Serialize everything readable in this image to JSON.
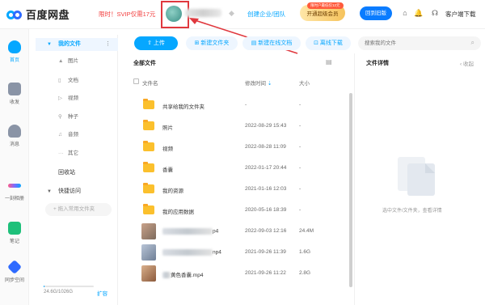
{
  "header": {
    "logo_text": "百度网盘",
    "promo_text": "限时！SVIP仅需17元",
    "team_link": "创建企业/团队",
    "vip_tag": "限时户最低仅12元",
    "vip_button": "开通超级会员",
    "return_button": "回到旧版",
    "client_download": "客户端下载"
  },
  "leftnav": {
    "items": [
      {
        "label": "首页",
        "icon": "cloud-icon",
        "color": "#06a7ff"
      },
      {
        "label": "收发",
        "icon": "inbox-icon",
        "color": "#8a94a6"
      },
      {
        "label": "消息",
        "icon": "person-icon",
        "color": "#8a94a6"
      },
      {
        "label": "一刻相册",
        "icon": "album-icon",
        "color": "#7b6cff"
      },
      {
        "label": "笔记",
        "icon": "note-icon",
        "color": "#1ec07a"
      },
      {
        "label": "同步空间",
        "icon": "sync-icon",
        "color": "#2f6bff"
      }
    ]
  },
  "sidebar": {
    "my_files": "我的文件",
    "sub_items": [
      {
        "label": "图片",
        "icon": "image-icon"
      },
      {
        "label": "文档",
        "icon": "doc-icon"
      },
      {
        "label": "视频",
        "icon": "video-icon"
      },
      {
        "label": "种子",
        "icon": "seed-icon"
      },
      {
        "label": "音频",
        "icon": "audio-icon"
      },
      {
        "label": "其它",
        "icon": "more-icon"
      }
    ],
    "recycle": "回收站",
    "quick_access": "快捷访问",
    "add_access": "+ 拖入常用文件夹",
    "storage_text": "24.6G/1026G",
    "storage_fraction": 0.024,
    "expand": "扩容"
  },
  "toolbar": {
    "upload": "上传",
    "new_folder": "新建文件夹",
    "new_online_doc": "新建在线文档",
    "offline_download": "离线下载",
    "search_placeholder": "搜索我的文件"
  },
  "file_list": {
    "title": "全部文件",
    "col_name": "文件名",
    "col_date": "修改时间",
    "col_size": "大小",
    "rows": [
      {
        "name": "共享给我的文件夹",
        "date": "-",
        "size": "-",
        "type": "folder"
      },
      {
        "name": "照片",
        "date": "2022-08-29 15:43",
        "size": "-",
        "type": "folder"
      },
      {
        "name": "视频",
        "date": "2022-08-28 11:09",
        "size": "-",
        "type": "folder"
      },
      {
        "name": "香囊",
        "date": "2022-01-17 20:44",
        "size": "-",
        "type": "folder"
      },
      {
        "name": "我的资源",
        "date": "2021-01-16 12:03",
        "size": "-",
        "type": "folder"
      },
      {
        "name": "我的应用数据",
        "date": "2020-05-16 18:39",
        "size": "-",
        "type": "folder"
      },
      {
        "name": "p4",
        "date": "2022-09-03 12:16",
        "size": "24.4M",
        "type": "video"
      },
      {
        "name": "np4",
        "date": "2021-09-26 11:39",
        "size": "1.6G",
        "type": "video"
      },
      {
        "name": "黄色香囊.mp4",
        "date": "2021-09-26 11:22",
        "size": "2.8G",
        "type": "video"
      }
    ]
  },
  "detail": {
    "title": "文件详情",
    "collapse": "收起",
    "empty_text": "选中文件/文件夹，查看详情"
  }
}
